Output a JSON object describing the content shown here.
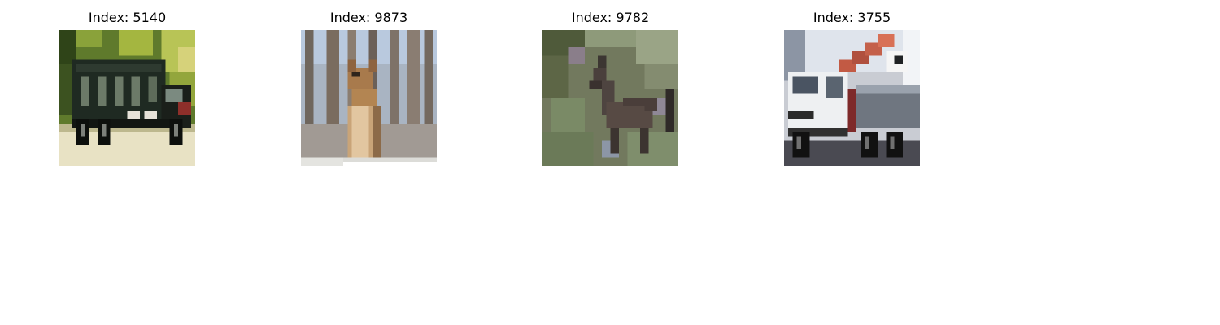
{
  "figure": {
    "panels": [
      {
        "title": "Index: 5140",
        "depicts": "truck-photo"
      },
      {
        "title": "Index: 9873",
        "depicts": "deer-photo"
      },
      {
        "title": "Index: 9782",
        "depicts": "deer-photo"
      },
      {
        "title": "Index: 3755",
        "depicts": "truck-photo"
      }
    ]
  }
}
